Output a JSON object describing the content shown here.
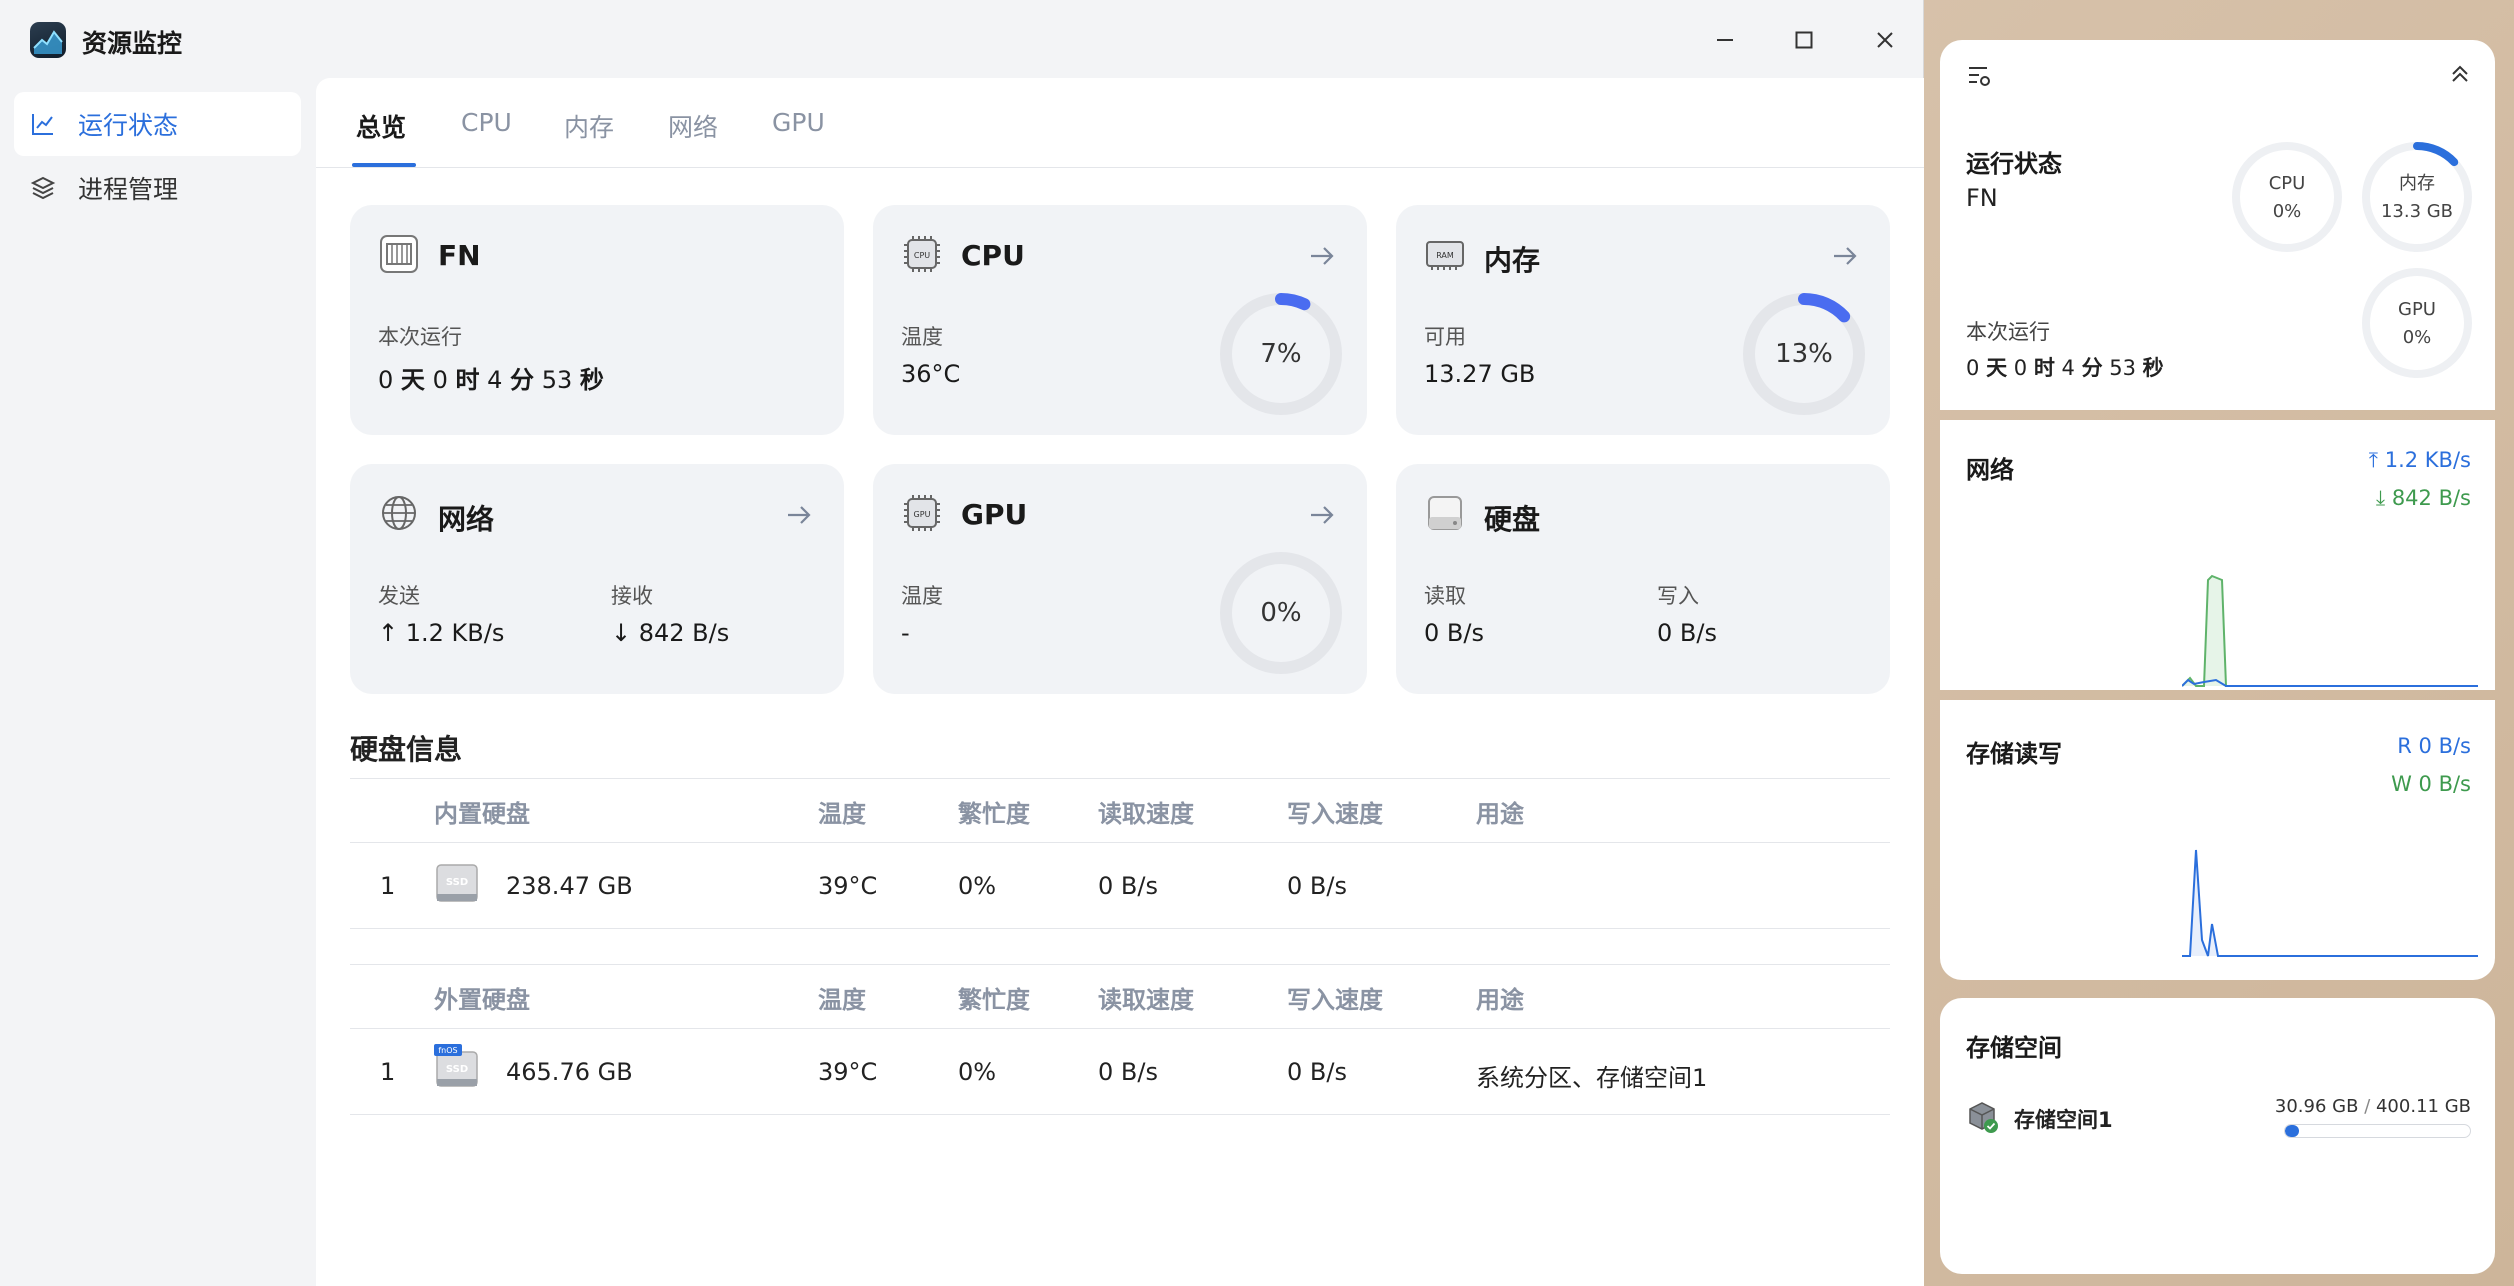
{
  "app": {
    "title": "资源监控"
  },
  "sidebar": {
    "items": [
      {
        "label": "运行状态"
      },
      {
        "label": "进程管理"
      }
    ]
  },
  "tabs": [
    {
      "label": "总览"
    },
    {
      "label": "CPU"
    },
    {
      "label": "内存"
    },
    {
      "label": "网络"
    },
    {
      "label": "GPU"
    }
  ],
  "cards": {
    "fn": {
      "title": "FN",
      "label": "本次运行",
      "uptime": {
        "days": "0",
        "days_unit": "天",
        "hours": "0",
        "hours_unit": "时",
        "minutes": "4",
        "minutes_unit": "分",
        "seconds": "53",
        "seconds_unit": "秒"
      }
    },
    "cpu": {
      "title": "CPU",
      "label": "温度",
      "value": "36°C",
      "percent": 7,
      "percent_text": "7%"
    },
    "memory": {
      "title": "内存",
      "label": "可用",
      "value": "13.27 GB",
      "percent": 13,
      "percent_text": "13%"
    },
    "network": {
      "title": "网络",
      "send_label": "发送",
      "send_value": "↑ 1.2 KB/s",
      "recv_label": "接收",
      "recv_value": "↓ 842 B/s"
    },
    "gpu": {
      "title": "GPU",
      "label": "温度",
      "value": "-",
      "percent": 0,
      "percent_text": "0%"
    },
    "disk": {
      "title": "硬盘",
      "read_label": "读取",
      "read_value": "0 B/s",
      "write_label": "写入",
      "write_value": "0 B/s"
    }
  },
  "disk_info": {
    "title": "硬盘信息",
    "internal": {
      "headers": [
        "内置硬盘",
        "温度",
        "繁忙度",
        "读取速度",
        "写入速度",
        "用途"
      ],
      "rows": [
        {
          "index": "1",
          "icon_badge": "SSD",
          "size": "238.47 GB",
          "temp": "39°C",
          "busy": "0%",
          "read": "0 B/s",
          "write": "0 B/s",
          "usage": ""
        }
      ]
    },
    "external": {
      "headers": [
        "外置硬盘",
        "温度",
        "繁忙度",
        "读取速度",
        "写入速度",
        "用途"
      ],
      "rows": [
        {
          "index": "1",
          "icon_badge": "SSD",
          "icon_tag": "fnOS",
          "size": "465.76 GB",
          "temp": "39°C",
          "busy": "0%",
          "read": "0 B/s",
          "write": "0 B/s",
          "usage": "系统分区、存储空间1"
        }
      ]
    }
  },
  "widgets": {
    "status": {
      "title": "运行状态",
      "name": "FN",
      "uptime_label": "本次运行",
      "uptime": {
        "days": "0",
        "days_unit": "天",
        "hours": "0",
        "hours_unit": "时",
        "minutes": "4",
        "minutes_unit": "分",
        "seconds": "53",
        "seconds_unit": "秒"
      },
      "rings": [
        {
          "label": "CPU",
          "value": "0%",
          "percent": 0
        },
        {
          "label": "内存",
          "value": "13.3 GB",
          "percent": 13
        },
        {
          "label": "GPU",
          "value": "0%",
          "percent": 0
        }
      ]
    },
    "network": {
      "title": "网络",
      "up": "1.2 KB/s",
      "down": "842 B/s"
    },
    "storage_io": {
      "title": "存储读写",
      "read_prefix": "R",
      "read": "0 B/s",
      "write_prefix": "W",
      "write": "0 B/s"
    },
    "storage_space": {
      "title": "存储空间",
      "volume": "存储空间1",
      "used": "30.96 GB",
      "separator": " / ",
      "total": "400.11 GB",
      "used_fraction": 0.077
    }
  },
  "colors": {
    "accent": "#2b6fdc",
    "gauge_fill": "#4a6cf0",
    "green": "#3e9a4e",
    "card_bg": "#f1f3f6"
  }
}
